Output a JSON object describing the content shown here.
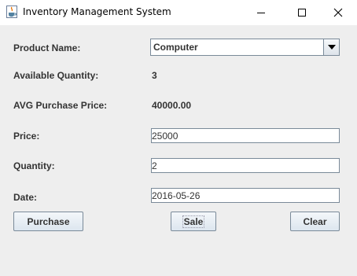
{
  "window": {
    "title": "Inventory Management System",
    "icons": {
      "app": "java-cup-icon",
      "minimize": "minimize-icon",
      "maximize": "maximize-icon",
      "close": "close-icon"
    }
  },
  "form": {
    "product_name": {
      "label": "Product Name:",
      "selected": "Computer"
    },
    "available_quantity": {
      "label": "Available Quantity:",
      "value": "3"
    },
    "avg_purchase_price": {
      "label": "AVG Purchase Price:",
      "value": "40000.00"
    },
    "price": {
      "label": "Price:",
      "value": "25000"
    },
    "quantity": {
      "label": "Quantity:",
      "value": "2"
    },
    "date": {
      "label": "Date:",
      "value": "2016-05-26"
    }
  },
  "buttons": {
    "purchase": "Purchase",
    "sale": "Sale",
    "clear": "Clear"
  },
  "colors": {
    "background": "#eeeeee",
    "field_border": "#7a8a99",
    "text": "#333333"
  }
}
